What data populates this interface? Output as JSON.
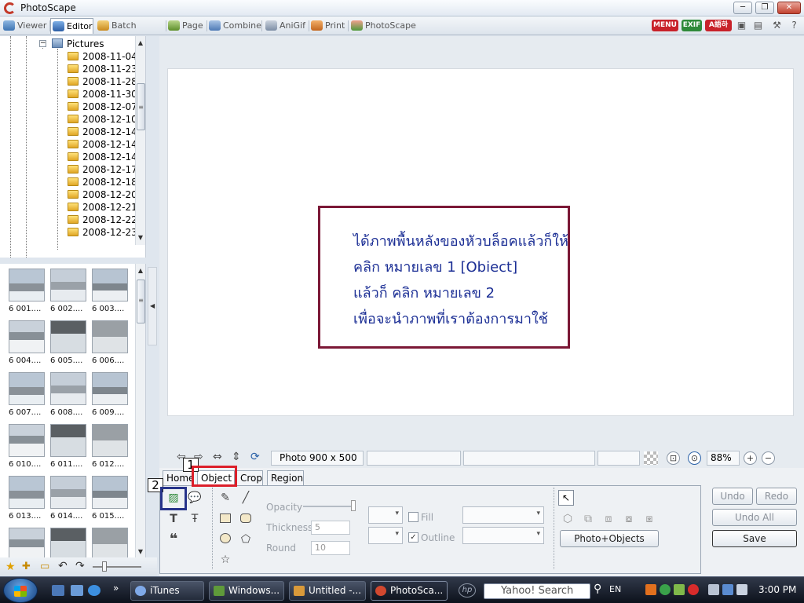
{
  "window": {
    "title": "PhotoScape"
  },
  "main_tabs": [
    {
      "label": "Viewer",
      "active": false
    },
    {
      "label": "Editor",
      "active": true
    },
    {
      "label": "Batch Editor",
      "active": false
    },
    {
      "label": "Page",
      "active": false
    },
    {
      "label": "Combine",
      "active": false
    },
    {
      "label": "AniGif",
      "active": false
    },
    {
      "label": "Print",
      "active": false
    },
    {
      "label": "PhotoScape",
      "active": false
    }
  ],
  "toolbar_right": {
    "menu": "MENU",
    "exif": "EXIF",
    "lang": "A語하"
  },
  "tree": {
    "root": "Pictures",
    "folders": [
      "2008-11-04",
      "2008-11-23",
      "2008-11-28",
      "2008-11-30",
      "2008-12-07",
      "2008-12-10",
      "2008-12-14",
      "2008-12-14",
      "2008-12-14",
      "2008-12-17",
      "2008-12-18",
      "2008-12-20",
      "2008-12-21",
      "2008-12-22",
      "2008-12-23"
    ]
  },
  "thumbnails": [
    "6 001....",
    "6 002....",
    "6 003....",
    "6 004....",
    "6 005....",
    "6 006....",
    "6 007....",
    "6 008....",
    "6 009....",
    "6 010....",
    "6 011....",
    "6 012....",
    "6 013....",
    "6 014....",
    "6 015....",
    "",
    "",
    ""
  ],
  "canvas": {
    "message_lines": [
      "ได้ภาพพื้นหลังของหัวบล็อคแล้วก็ให้",
      "คลิก หมายเลข 1 [Obiect]",
      "แล้วก็ คลิก หมายเลข 2",
      "เพื่อจะนำภาพที่เราต้องการมาใช้"
    ]
  },
  "status": {
    "photo_size": "Photo 900 x 500",
    "zoom": "88%"
  },
  "edit_tabs": [
    {
      "label": "Home",
      "active": false
    },
    {
      "label": "Object",
      "active": true
    },
    {
      "label": "Crop",
      "active": false
    },
    {
      "label": "Region",
      "active": false
    }
  ],
  "object_panel": {
    "opacity_label": "Opacity",
    "thickness_label": "Thickness",
    "thickness_value": "5",
    "round_label": "Round",
    "round_value": "10",
    "fill_label": "Fill",
    "outline_label": "Outline",
    "photo_objects_button": "Photo+Objects"
  },
  "history": {
    "undo": "Undo",
    "redo": "Redo",
    "undo_all": "Undo All",
    "save": "Save"
  },
  "annotations": {
    "label1": "1",
    "label2": "2"
  },
  "taskbar": {
    "tasks": [
      "iTunes",
      "Windows...",
      "Untitled -...",
      "PhotoSca..."
    ],
    "search_placeholder": "Yahoo! Search",
    "language": "EN",
    "clock": "3:00 PM"
  }
}
